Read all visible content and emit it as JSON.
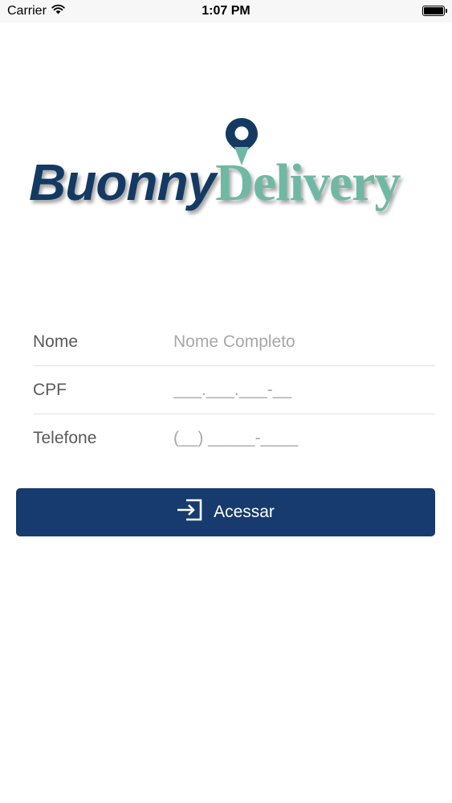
{
  "status_bar": {
    "carrier": "Carrier",
    "time": "1:07 PM",
    "icons": [
      "wifi-icon",
      "battery-icon"
    ]
  },
  "logo": {
    "word1": "Buonny",
    "word2": "Delivery",
    "colors": {
      "primary": "#143a63",
      "secondary": "#6fb9a4"
    },
    "icon": "location-pin-icon"
  },
  "form": {
    "nome": {
      "label": "Nome",
      "placeholder": "Nome Completo",
      "value": ""
    },
    "cpf": {
      "label": "CPF",
      "placeholder": "___.___.___-__",
      "value": ""
    },
    "telefone": {
      "label": "Telefone",
      "placeholder": "(__) _____-____",
      "value": ""
    }
  },
  "submit": {
    "label": "Acessar",
    "icon": "login-icon",
    "color": "#173b6e"
  }
}
